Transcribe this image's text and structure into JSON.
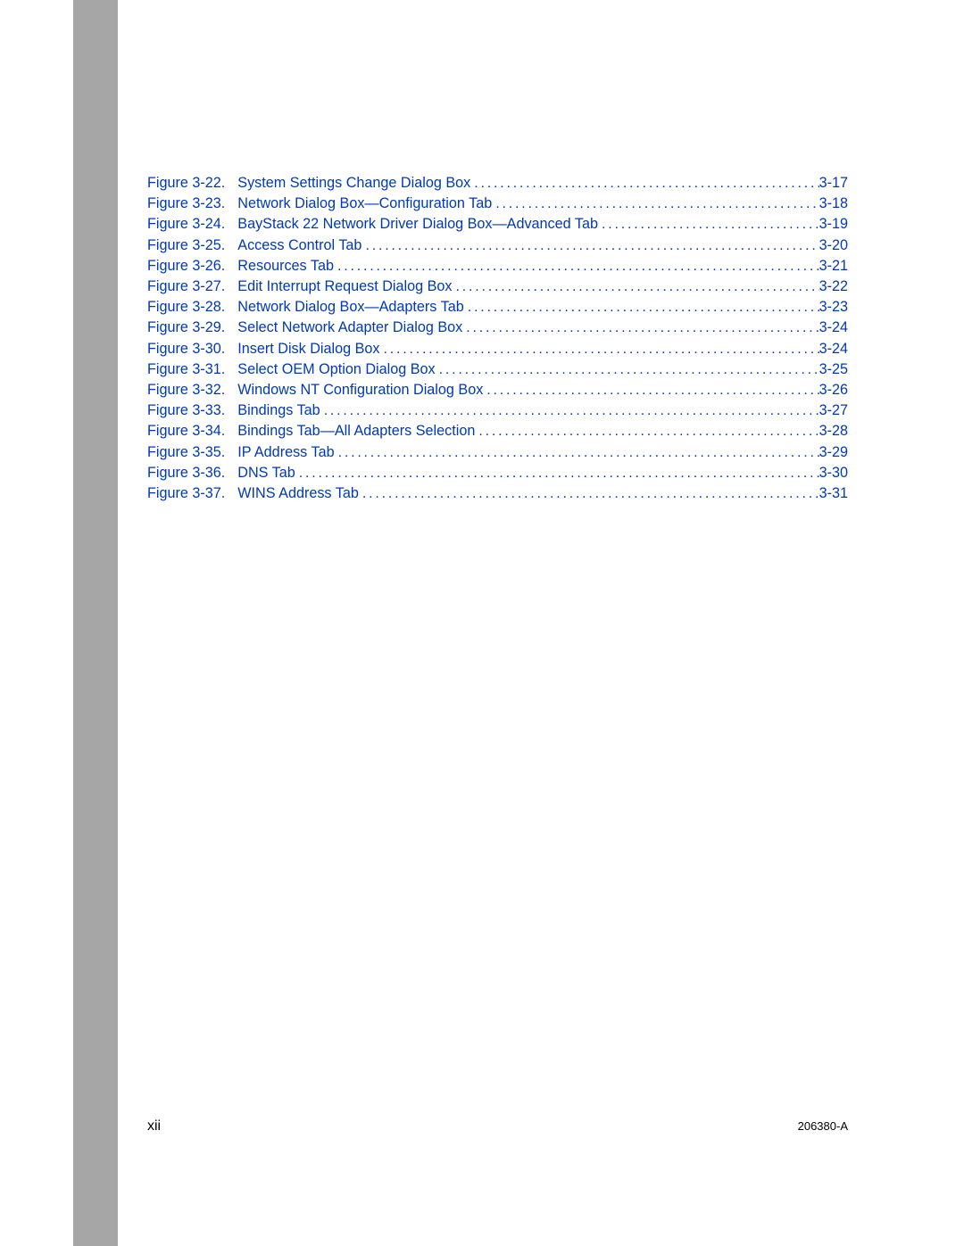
{
  "entries": [
    {
      "label": "Figure 3-22.",
      "title": "System Settings Change Dialog Box",
      "page": "3-17"
    },
    {
      "label": "Figure 3-23.",
      "title": "Network Dialog Box—Configuration Tab",
      "page": "3-18"
    },
    {
      "label": "Figure 3-24.",
      "title": "BayStack 22 Network Driver Dialog Box—Advanced Tab",
      "page": "3-19"
    },
    {
      "label": "Figure 3-25.",
      "title": "Access Control Tab",
      "page": "3-20"
    },
    {
      "label": "Figure 3-26.",
      "title": "Resources Tab",
      "page": "3-21"
    },
    {
      "label": "Figure 3-27.",
      "title": "Edit Interrupt Request Dialog Box",
      "page": "3-22"
    },
    {
      "label": "Figure 3-28.",
      "title": "Network Dialog Box—Adapters Tab",
      "page": "3-23"
    },
    {
      "label": "Figure 3-29.",
      "title": "Select Network Adapter Dialog Box",
      "page": "3-24"
    },
    {
      "label": "Figure 3-30.",
      "title": "Insert Disk Dialog Box",
      "page": "3-24"
    },
    {
      "label": "Figure 3-31.",
      "title": "Select OEM Option Dialog Box",
      "page": "3-25"
    },
    {
      "label": "Figure 3-32.",
      "title": "Windows NT Configuration Dialog Box",
      "page": "3-26"
    },
    {
      "label": "Figure 3-33.",
      "title": "Bindings Tab",
      "page": "3-27"
    },
    {
      "label": "Figure 3-34.",
      "title": "Bindings Tab—All Adapters Selection",
      "page": "3-28"
    },
    {
      "label": "Figure 3-35.",
      "title": "IP Address Tab",
      "page": "3-29"
    },
    {
      "label": "Figure 3-36.",
      "title": "DNS Tab",
      "page": "3-30"
    },
    {
      "label": "Figure 3-37.",
      "title": "WINS Address Tab",
      "page": "3-31"
    }
  ],
  "footer": {
    "page_number": "xii",
    "doc_number": "206380-A"
  },
  "dots": "................................................................................................................................................"
}
